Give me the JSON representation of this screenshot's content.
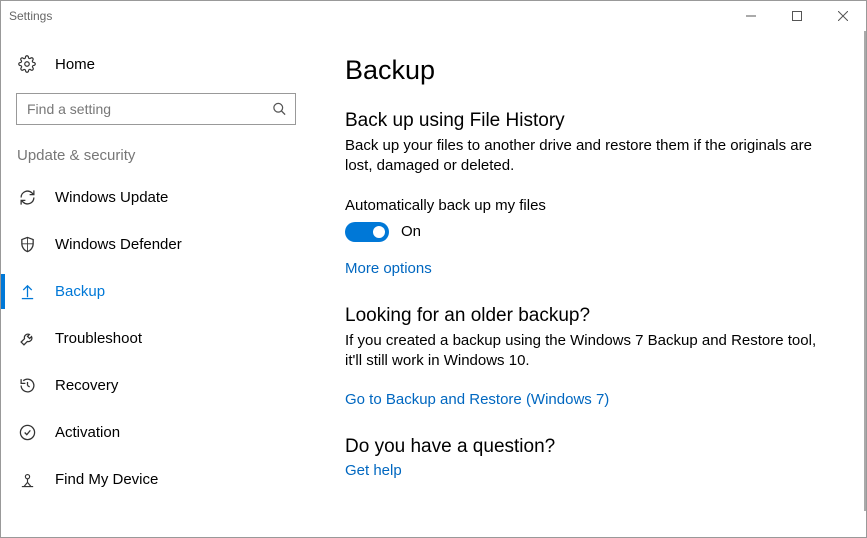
{
  "window": {
    "title": "Settings"
  },
  "sidebar": {
    "home_label": "Home",
    "search_placeholder": "Find a setting",
    "section_label": "Update & security",
    "items": [
      {
        "label": "Windows Update"
      },
      {
        "label": "Windows Defender"
      },
      {
        "label": "Backup"
      },
      {
        "label": "Troubleshoot"
      },
      {
        "label": "Recovery"
      },
      {
        "label": "Activation"
      },
      {
        "label": "Find My Device"
      }
    ]
  },
  "main": {
    "page_title": "Backup",
    "fh_heading": "Back up using File History",
    "fh_desc": "Back up your files to another drive and restore them if the originals are lost, damaged or deleted.",
    "toggle_label": "Automatically back up my files",
    "toggle_state": "On",
    "more_options": "More options",
    "older_heading": "Looking for an older backup?",
    "older_desc": "If you created a backup using the Windows 7 Backup and Restore tool, it'll still work in Windows 10.",
    "older_link": "Go to Backup and Restore (Windows 7)",
    "question_heading": "Do you have a question?",
    "get_help": "Get help"
  }
}
